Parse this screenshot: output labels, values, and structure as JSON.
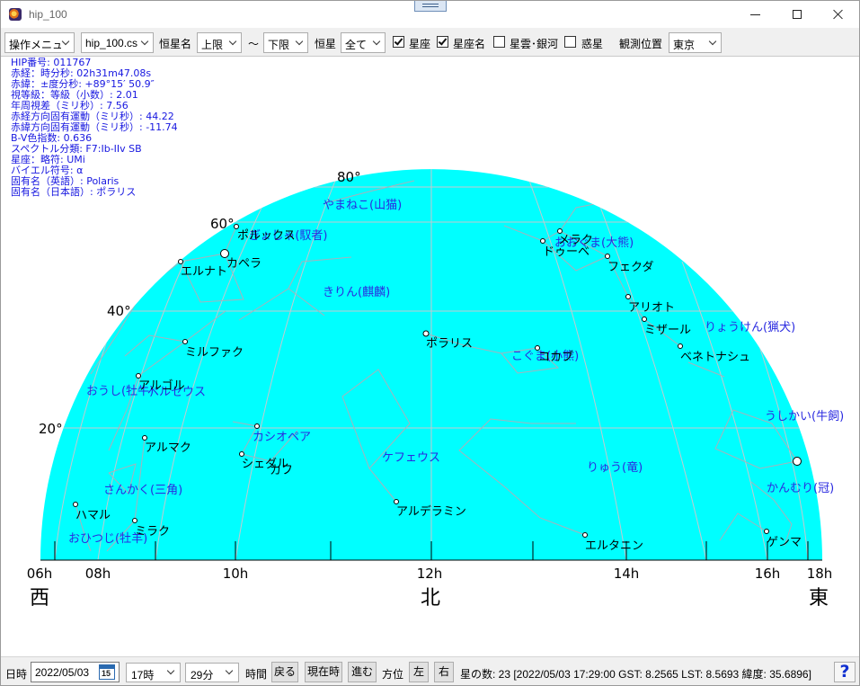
{
  "window": {
    "title": "hip_100",
    "icons": {
      "app": "app-icon",
      "minimize": "minimize-icon",
      "maximize": "maximize-icon",
      "close": "close-icon"
    }
  },
  "toolbar": {
    "menu_value": "操作メニュ",
    "file_value": "hip_100.cs",
    "star_name_label": "恒星名",
    "upper_value": "上限",
    "range_sep": "～",
    "lower_value": "下限",
    "star_label": "恒星",
    "star_filter_value": "全て",
    "checkboxes": [
      {
        "label": "星座",
        "checked": true
      },
      {
        "label": "星座名",
        "checked": true
      },
      {
        "label": "星雲･銀河",
        "checked": false
      },
      {
        "label": "惑星",
        "checked": false
      }
    ],
    "location_label": "観測位置",
    "location_value": "東京"
  },
  "info": [
    "HIP番号: 011767",
    "赤経：時分秒: 02h31m47.08s",
    "赤緯：±度分秒: +89°15′ 50.9″",
    "視等級：等級（小数）: 2.01",
    "年周視差（ミリ秒）: 7.56",
    "赤経方向固有運動（ミリ秒）: 44.22",
    "赤緯方向固有運動（ミリ秒）: -11.74",
    "B-V色指数: 0.636",
    "スペクトル分類: F7:Ib-IIv SB",
    "星座：略符: UMi",
    "バイエル符号: α",
    "固有名（英語）: Polaris",
    "固有名（日本語）: ポラリス"
  ],
  "chart": {
    "colors": {
      "sky": "#00ffff",
      "constellation_name": "#2a2ae0",
      "star_label": "#000000",
      "info_text": "#1717e0"
    },
    "altitude_labels": [
      "80°",
      "60°",
      "40°",
      "20°"
    ],
    "hour_labels": [
      "06h",
      "08h",
      "10h",
      "12h",
      "14h",
      "16h",
      "18h"
    ],
    "directions": {
      "west": "西",
      "north": "北",
      "east": "東"
    },
    "star_names": [
      "ポラリス",
      "ポルックス",
      "カペラ",
      "エルナト",
      "ミルファク",
      "アルゴル",
      "アルマク",
      "シェダル",
      "カフ",
      "ハマル",
      "ミラク",
      "アルデラミン",
      "ドゥーベ",
      "メラク",
      "フェクダ",
      "アリオト",
      "ミザール",
      "ベネトナシュ",
      "コカブ",
      "エルタニン",
      "ゲンマ"
    ],
    "constellation_names": [
      "やまねこ(山猫)",
      "ぎょしゃ(馭者)",
      "おおぐま(大熊)",
      "きりん(麒麟)",
      "りょうけん(猟犬)",
      "こぐま(小熊)",
      "おうし(牡牛)",
      "ペルセウス",
      "うしかい(牛飼)",
      "カシオペア",
      "ケフェウス",
      "りゅう(竜)",
      "さんかく(三角)",
      "かんむり(冠)",
      "おひつじ(牡羊)"
    ]
  },
  "statusbar": {
    "date_label": "日時",
    "date_value": "2022/05/03",
    "calendar_icon_day": "15",
    "hour_value": "17時",
    "minute_value": "29分",
    "time_label": "時間",
    "back_button": "戻る",
    "now_button": "現在時",
    "forward_button": "進む",
    "direction_label": "方位",
    "left_button": "左",
    "right_button": "右",
    "status_text": "星の数: 23 [2022/05/03 17:29:00 GST: 8.2565 LST: 8.5693 緯度: 35.6896]",
    "help_button": "?"
  }
}
